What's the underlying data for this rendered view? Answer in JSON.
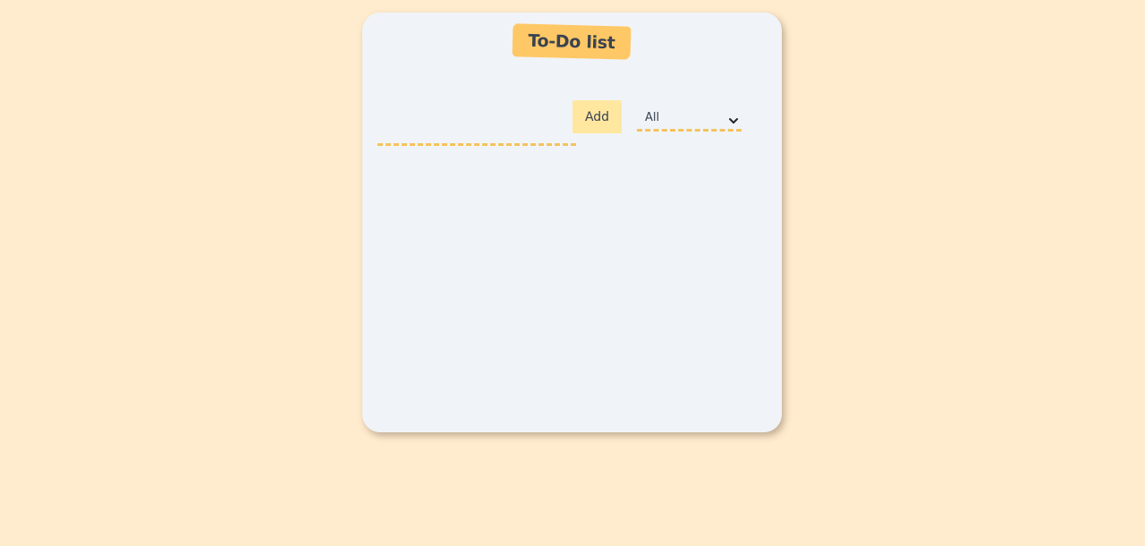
{
  "header": {
    "title": "To-Do list"
  },
  "form": {
    "task_input": {
      "value": "",
      "placeholder": ""
    },
    "add_label": "Add",
    "filter": {
      "selected": "All"
    }
  },
  "todos": [],
  "colors": {
    "page_background": "#ffebcd",
    "card_background": "#f0f4f8",
    "title_tag": "#ffc866",
    "add_button": "#ffe7a0",
    "dashed_underline": "#f5c25e",
    "text": "#3a4350"
  },
  "icons": {
    "filter_dropdown": "chevron-down-icon"
  }
}
